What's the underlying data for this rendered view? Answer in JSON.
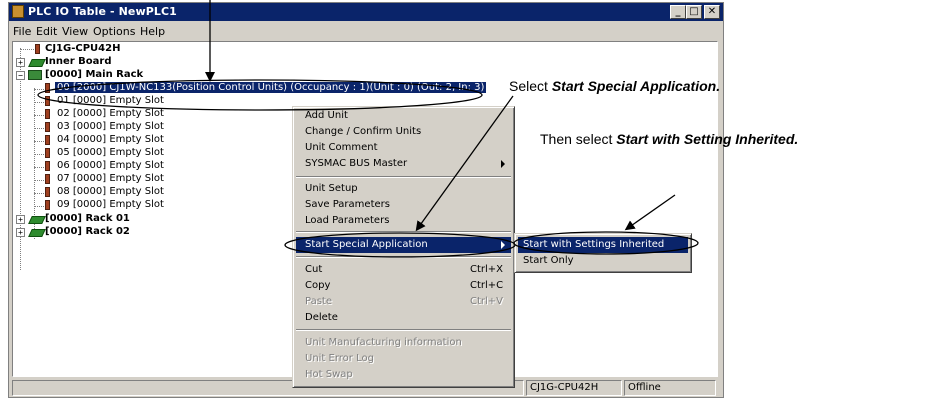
{
  "window": {
    "title": "PLC IO Table - NewPLC1",
    "controls": {
      "minimize": "_",
      "maximize": "□",
      "close": "✕"
    }
  },
  "menubar": [
    "File",
    "Edit",
    "View",
    "Options",
    "Help"
  ],
  "tree": {
    "cpu": "CJ1G-CPU42H",
    "inner_board": "Inner Board",
    "main_rack": "[0000] Main Rack",
    "slots": [
      "00 [2000] CJ1W-NC133(Position Control Units) (Occupancy : 1)(Unit : 0) (Out: 2, In: 3)",
      "01 [0000] Empty Slot",
      "02 [0000] Empty Slot",
      "03 [0000] Empty Slot",
      "04 [0000] Empty Slot",
      "05 [0000] Empty Slot",
      "06 [0000] Empty Slot",
      "07 [0000] Empty Slot",
      "08 [0000] Empty Slot",
      "09 [0000] Empty Slot"
    ],
    "rack01": "[0000] Rack 01",
    "rack02": "[0000] Rack 02"
  },
  "context_menu": {
    "items": [
      {
        "label": "Add Unit",
        "shortcut": "",
        "disabled": false
      },
      {
        "label": "Change / Confirm Units",
        "shortcut": "",
        "disabled": false
      },
      {
        "label": "Unit Comment",
        "shortcut": "",
        "disabled": false
      },
      {
        "label": "SYSMAC BUS Master",
        "shortcut": "",
        "disabled": false,
        "submenu": true
      },
      {
        "label": "Unit Setup",
        "shortcut": "",
        "disabled": false
      },
      {
        "label": "Save Parameters",
        "shortcut": "",
        "disabled": false
      },
      {
        "label": "Load Parameters",
        "shortcut": "",
        "disabled": false
      },
      {
        "label": "Start Special Application",
        "shortcut": "",
        "disabled": false,
        "submenu": true,
        "highlighted": true
      },
      {
        "label": "Cut",
        "shortcut": "Ctrl+X",
        "disabled": false
      },
      {
        "label": "Copy",
        "shortcut": "Ctrl+C",
        "disabled": false
      },
      {
        "label": "Paste",
        "shortcut": "Ctrl+V",
        "disabled": true
      },
      {
        "label": "Delete",
        "shortcut": "",
        "disabled": false
      },
      {
        "label": "Unit Manufacturing information",
        "shortcut": "",
        "disabled": true
      },
      {
        "label": "Unit Error Log",
        "shortcut": "",
        "disabled": true
      },
      {
        "label": "Hot Swap",
        "shortcut": "",
        "disabled": true
      }
    ]
  },
  "submenu": {
    "items": [
      {
        "label": "Start with Settings Inherited",
        "highlighted": true
      },
      {
        "label": "Start Only",
        "highlighted": false
      }
    ]
  },
  "statusbar": {
    "model": "CJ1G-CPU42H",
    "mode": "Offline"
  },
  "callouts": {
    "first_prefix": "Select ",
    "first_bold": "Start Special Application.",
    "second_prefix": "Then select ",
    "second_bold": "Start with Setting Inherited."
  },
  "colors": {
    "selection": "#0a246a",
    "face": "#d4d0c8"
  }
}
